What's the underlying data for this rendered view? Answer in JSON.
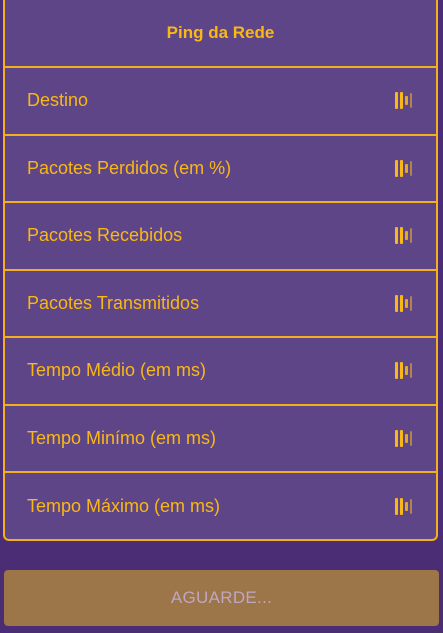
{
  "panel": {
    "title": "Ping da Rede",
    "rows": [
      {
        "label": "Destino",
        "icon": "signal-bars-icon"
      },
      {
        "label": "Pacotes Perdidos (em %)",
        "icon": "signal-bars-icon"
      },
      {
        "label": "Pacotes Recebidos",
        "icon": "signal-bars-icon"
      },
      {
        "label": "Pacotes Transmitidos",
        "icon": "signal-bars-icon"
      },
      {
        "label": "Tempo Médio (em ms)",
        "icon": "signal-bars-icon"
      },
      {
        "label": "Tempo Minímo (em ms)",
        "icon": "signal-bars-icon"
      },
      {
        "label": "Tempo Máximo (em ms)",
        "icon": "signal-bars-icon"
      }
    ]
  },
  "action": {
    "wait_label": "AGUARDE..."
  },
  "colors": {
    "background": "#4a2d74",
    "panel": "#5e4588",
    "accent": "#f9b815",
    "button": "#9c7548",
    "button_text": "#bfa7c2"
  }
}
